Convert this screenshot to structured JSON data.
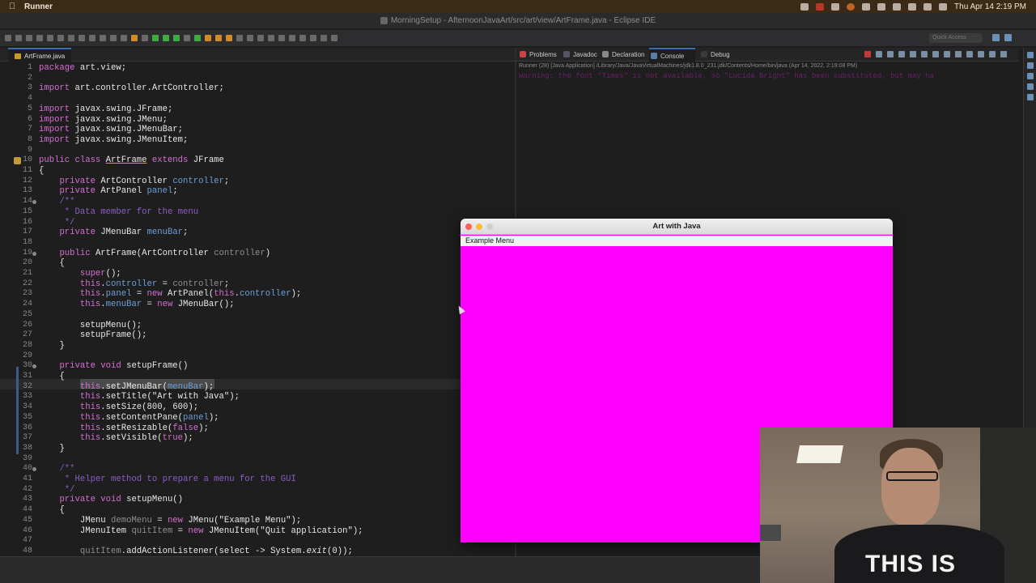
{
  "menubar": {
    "app_name": "Runner",
    "clock": "Thu Apr 14  2:19 PM"
  },
  "window": {
    "title": "MorningSetup - AfternoonJavaArt/src/art/view/ArtFrame.java - Eclipse IDE"
  },
  "toolbar": {
    "quick_access_placeholder": "Quick Access"
  },
  "editor": {
    "tab_label": "ArtFrame.java",
    "lines": [
      {
        "n": "1",
        "html": "<span class=\"kw\">package</span> <span class=\"pl\">art.view;</span>"
      },
      {
        "n": "2",
        "html": ""
      },
      {
        "n": "3",
        "html": "<span class=\"kw\">import</span> <span class=\"pl\">art.controller.ArtController;</span>"
      },
      {
        "n": "4",
        "html": ""
      },
      {
        "n": "5",
        "html": "<span class=\"kw\">import</span> <span class=\"pl\">javax.swing.JFrame;</span>"
      },
      {
        "n": "6",
        "html": "<span class=\"kw\">import</span> <span class=\"pl\">javax.swing.JMenu;</span>"
      },
      {
        "n": "7",
        "html": "<span class=\"kw\">import</span> <span class=\"pl\">javax.swing.JMenuBar;</span>"
      },
      {
        "n": "8",
        "html": "<span class=\"kw\">import</span> <span class=\"pl\">javax.swing.JMenuItem;</span>"
      },
      {
        "n": "9",
        "html": ""
      },
      {
        "n": "10",
        "html": "<span class=\"kw\">public class</span> <span class=\"cls\">ArtFrame</span> <span class=\"kw\">extends</span> <span class=\"pl\">JFrame</span>"
      },
      {
        "n": "11",
        "html": "<span class=\"pl\">{</span>"
      },
      {
        "n": "12",
        "html": "    <span class=\"kw\">private</span> <span class=\"pl\">ArtController</span> <span class=\"fld\">controller</span><span class=\"pl\">;</span>"
      },
      {
        "n": "13",
        "html": "    <span class=\"kw\">private</span> <span class=\"pl\">ArtPanel</span> <span class=\"fld\">panel</span><span class=\"pl\">;</span>"
      },
      {
        "n": "14",
        "html": "    <span class=\"cm\">/**</span>"
      },
      {
        "n": "15",
        "html": "     <span class=\"cm\">* Data member for the menu</span>"
      },
      {
        "n": "16",
        "html": "     <span class=\"cm\">*/</span>"
      },
      {
        "n": "17",
        "html": "    <span class=\"kw\">private</span> <span class=\"pl\">JMenuBar</span> <span class=\"fld\">menuBar</span><span class=\"pl\">;</span>"
      },
      {
        "n": "18",
        "html": ""
      },
      {
        "n": "19",
        "html": "    <span class=\"kw\">public</span> <span class=\"pl\">ArtFrame(ArtController</span> <span class=\"lv\">controller</span><span class=\"pl\">)</span>"
      },
      {
        "n": "20",
        "html": "    <span class=\"pl\">{</span>"
      },
      {
        "n": "21",
        "html": "        <span class=\"kw\">super</span><span class=\"pl\">();</span>"
      },
      {
        "n": "22",
        "html": "        <span class=\"kw\">this</span><span class=\"pl\">.</span><span class=\"fld\">controller</span> <span class=\"pl\">=</span> <span class=\"lv\">controller</span><span class=\"pl\">;</span>"
      },
      {
        "n": "23",
        "html": "        <span class=\"kw\">this</span><span class=\"pl\">.</span><span class=\"fld\">panel</span> <span class=\"pl\">=</span> <span class=\"kw\">new</span> <span class=\"pl\">ArtPanel(</span><span class=\"kw\">this</span><span class=\"pl\">.</span><span class=\"fld\">controller</span><span class=\"pl\">);</span>"
      },
      {
        "n": "24",
        "html": "        <span class=\"kw\">this</span><span class=\"pl\">.</span><span class=\"fld\">menuBar</span> <span class=\"pl\">=</span> <span class=\"kw\">new</span> <span class=\"pl\">JMenuBar();</span>"
      },
      {
        "n": "25",
        "html": ""
      },
      {
        "n": "26",
        "html": "        <span class=\"pl\">setupMenu();</span>"
      },
      {
        "n": "27",
        "html": "        <span class=\"pl\">setupFrame();</span>"
      },
      {
        "n": "28",
        "html": "    <span class=\"pl\">}</span>"
      },
      {
        "n": "29",
        "html": ""
      },
      {
        "n": "30",
        "html": "    <span class=\"kw\">private void</span> <span class=\"pl\">setupFrame()</span>"
      },
      {
        "n": "31",
        "html": "    <span class=\"pl\">{</span>"
      },
      {
        "n": "32",
        "html": "        <span class=\"kw\">this</span><span class=\"pl\">.setJMenuBar(</span><span class=\"fld\">menuBar</span><span class=\"pl\">);</span>"
      },
      {
        "n": "33",
        "html": "        <span class=\"kw\">this</span><span class=\"pl\">.setTitle(\"Art with Java\");</span>"
      },
      {
        "n": "34",
        "html": "        <span class=\"kw\">this</span><span class=\"pl\">.setSize(800, 600);</span>"
      },
      {
        "n": "35",
        "html": "        <span class=\"kw\">this</span><span class=\"pl\">.setContentPane(</span><span class=\"fld\">panel</span><span class=\"pl\">);</span>"
      },
      {
        "n": "36",
        "html": "        <span class=\"kw\">this</span><span class=\"pl\">.setResizable(</span><span class=\"kw\">false</span><span class=\"pl\">);</span>"
      },
      {
        "n": "37",
        "html": "        <span class=\"kw\">this</span><span class=\"pl\">.setVisible(</span><span class=\"kw\">true</span><span class=\"pl\">);</span>"
      },
      {
        "n": "38",
        "html": "    <span class=\"pl\">}</span>"
      },
      {
        "n": "39",
        "html": ""
      },
      {
        "n": "40",
        "html": "    <span class=\"cm\">/**</span>"
      },
      {
        "n": "41",
        "html": "     <span class=\"cm\">* Helper method to prepare a menu for the GUI</span>"
      },
      {
        "n": "42",
        "html": "     <span class=\"cm\">*/</span>"
      },
      {
        "n": "43",
        "html": "    <span class=\"kw\">private void</span> <span class=\"pl\">setupMenu()</span>"
      },
      {
        "n": "44",
        "html": "    <span class=\"pl\">{</span>"
      },
      {
        "n": "45",
        "html": "        <span class=\"pl\">JMenu</span> <span class=\"lv\">demoMenu</span> <span class=\"pl\">=</span> <span class=\"kw\">new</span> <span class=\"pl\">JMenu(\"Example Menu\");</span>"
      },
      {
        "n": "46",
        "html": "        <span class=\"pl\">JMenuItem</span> <span class=\"lv\">quitItem</span> <span class=\"pl\">=</span> <span class=\"kw\">new</span> <span class=\"pl\">JMenuItem(\"Quit application\");</span>"
      },
      {
        "n": "47",
        "html": ""
      },
      {
        "n": "48",
        "html": "        <span class=\"lv\">quitItem</span><span class=\"pl\">.addActionListener(select -> System.</span><span class=\"pl\"><i>exit</i></span><span class=\"pl\">(0));</span>"
      }
    ]
  },
  "console_tabs": {
    "problems": "Problems",
    "javadoc": "Javadoc",
    "declaration": "Declaration",
    "console": "Console",
    "debug": "Debug"
  },
  "console": {
    "header": "Runner (28) [Java Application] /Library/Java/JavaVirtualMachines/jdk1.8.0_231.jdk/Contents/Home/bin/java (Apr 14, 2022, 2:19:08 PM)",
    "message": "Warning: the font \"Times\" is not available, so \"Lucida Bright\" has been substituted, but may ha"
  },
  "app_window": {
    "title": "Art with Java",
    "menu_label": "Example Menu",
    "canvas_color": "#ff00ff"
  },
  "webcam": {
    "shirt_text": "THIS IS"
  }
}
